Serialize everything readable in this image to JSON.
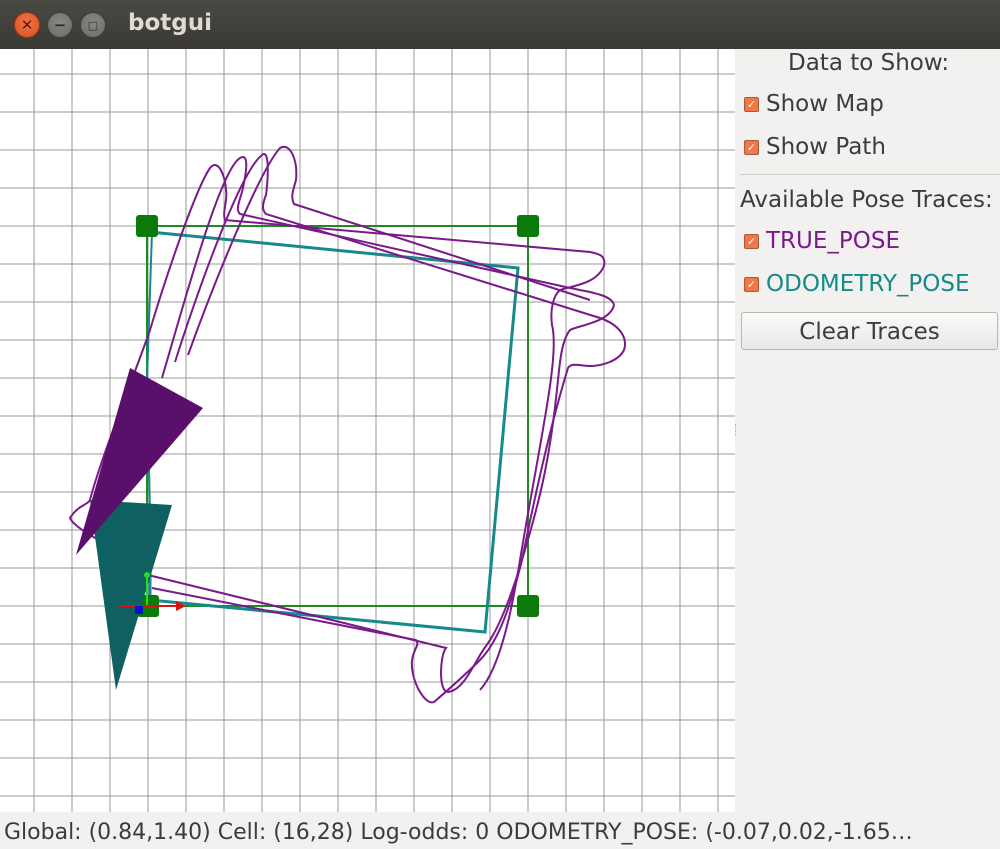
{
  "window": {
    "title": "botgui"
  },
  "panel": {
    "heading": "Data to Show:",
    "show_map": "Show Map",
    "show_path": "Show Path",
    "traces_heading": "Available Pose Traces:",
    "traces": [
      {
        "label": "TRUE_POSE",
        "color": "#7a1a8a"
      },
      {
        "label": "ODOMETRY_POSE",
        "color": "#158a8a"
      }
    ],
    "clear_label": "Clear Traces"
  },
  "status": {
    "text": "Global: (0.84,1.40) Cell: (16,28) Log-odds: 0    ODOMETRY_POSE: (-0.07,0.02,-1.65…"
  },
  "colors": {
    "true_pose": "#7a1a8a",
    "odometry_pose": "#158a8a",
    "true_pose_marker": "#5a0f6a",
    "odometry_pose_marker": "#0f6060",
    "path": "#1f8a1f",
    "waypoint": "#0a7a0a",
    "grid": "#999999",
    "checkbox": "#f07746"
  }
}
